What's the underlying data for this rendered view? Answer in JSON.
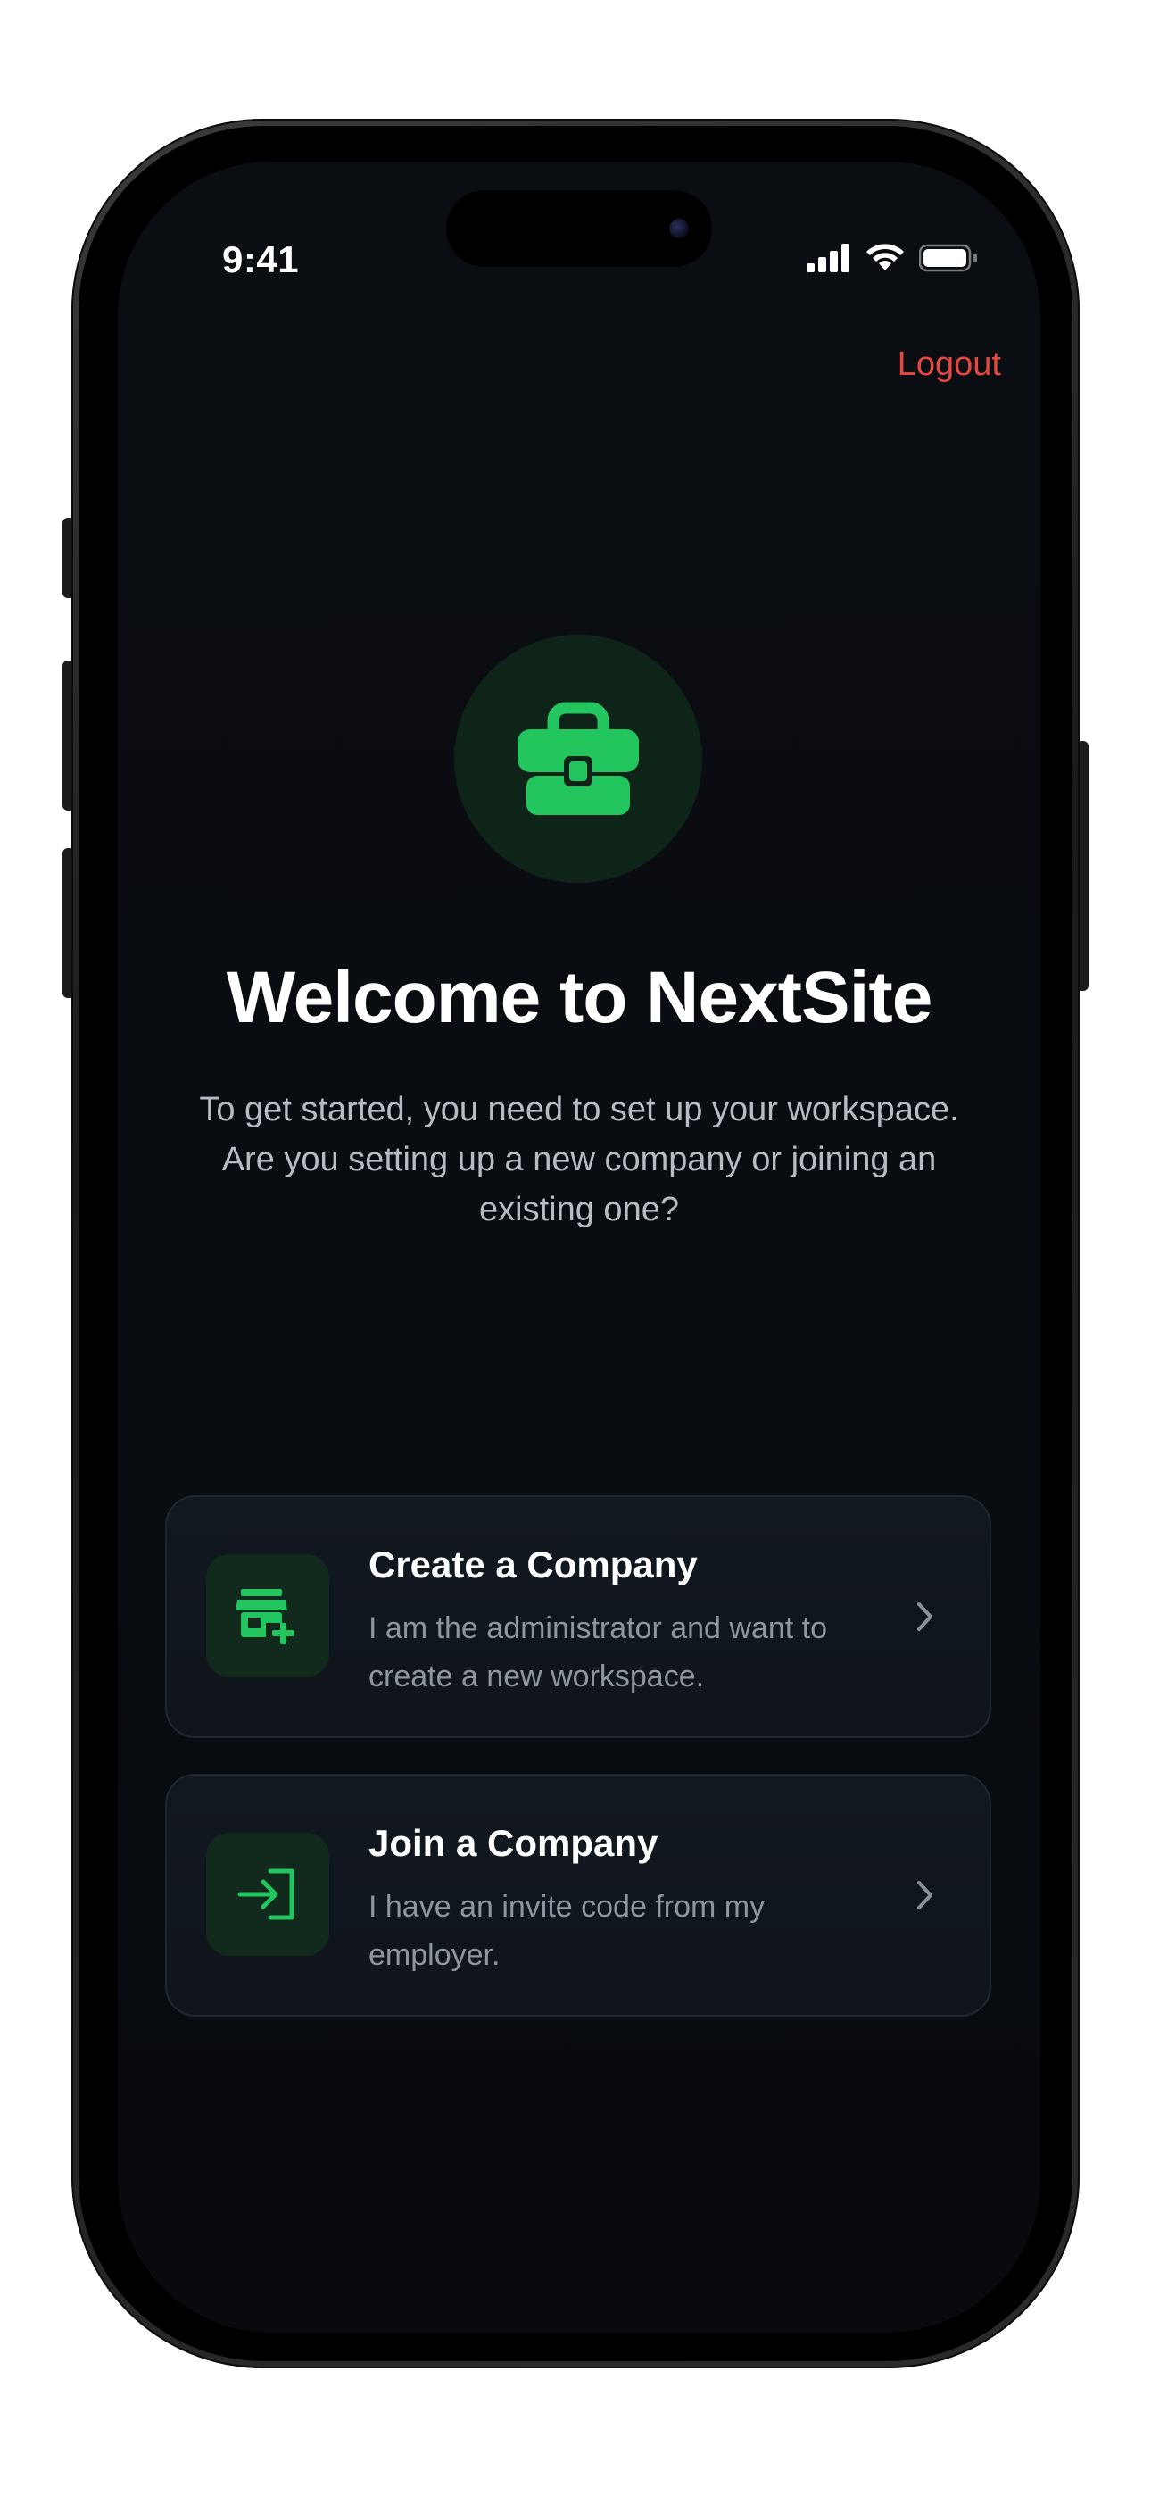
{
  "status_bar": {
    "time": "9:41"
  },
  "header": {
    "logout_label": "Logout"
  },
  "hero": {
    "icon": "briefcase-icon",
    "title": "Welcome to NextSite",
    "subtitle": "To get started, you need to set up your workspace. Are you setting up a new company or joining an existing one?"
  },
  "options": [
    {
      "icon": "storefront-add-icon",
      "title": "Create a Company",
      "description": "I am the administrator and want to create a new workspace."
    },
    {
      "icon": "login-arrow-icon",
      "title": "Join a Company",
      "description": "I have an invite code from my employer."
    }
  ],
  "colors": {
    "accent": "#22c55e",
    "logout": "#e5483f",
    "background": "#0a0d12",
    "card": "#121820"
  }
}
